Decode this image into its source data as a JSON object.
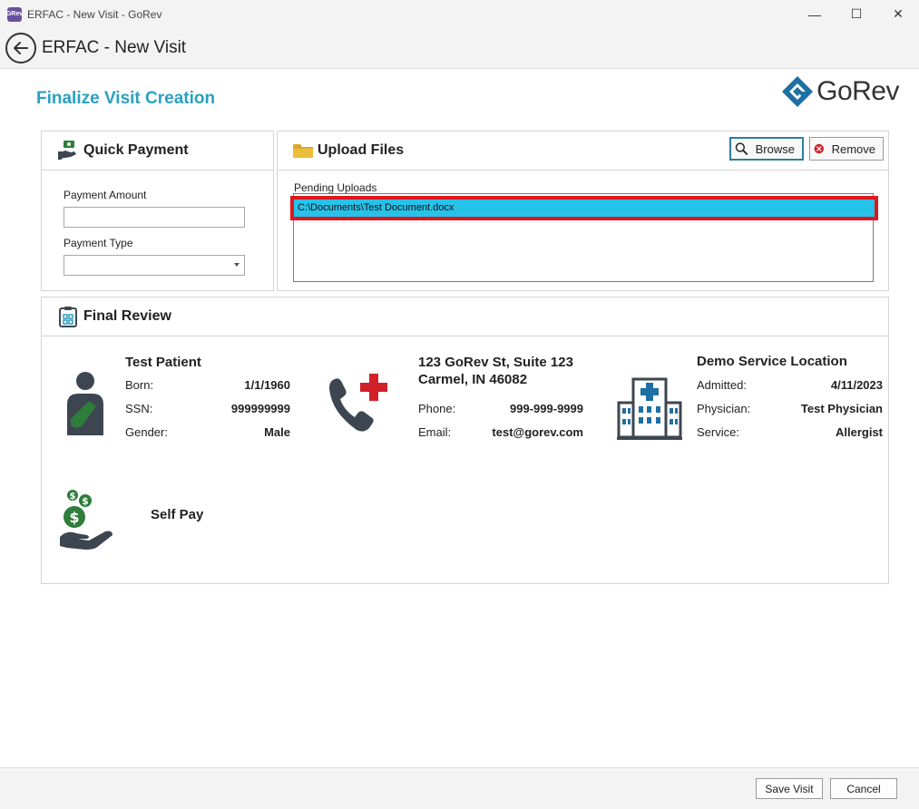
{
  "window": {
    "title": "ERFAC - New Visit - GoRev",
    "app_icon_text": "GRev",
    "minimize": "—",
    "maximize": "☐",
    "close": "✕"
  },
  "header": {
    "title": "ERFAC - New Visit"
  },
  "page": {
    "title": "Finalize Visit Creation"
  },
  "logo": {
    "text": "GoRev",
    "color": "#1e6fa3"
  },
  "quick_payment": {
    "title": "Quick Payment",
    "amount_label": "Payment Amount",
    "amount_value": "",
    "type_label": "Payment Type",
    "type_value": ""
  },
  "upload_files": {
    "title": "Upload Files",
    "browse_label": "Browse",
    "remove_label": "Remove",
    "pending_label": "Pending Uploads",
    "files": [
      "C:\\Documents\\Test Document.docx"
    ]
  },
  "final_review": {
    "title": "Final Review",
    "patient": {
      "name": "Test Patient",
      "born_label": "Born:",
      "born": "1/1/1960",
      "ssn_label": "SSN:",
      "ssn": "999999999",
      "gender_label": "Gender:",
      "gender": "Male"
    },
    "contact": {
      "address_line1": "123 GoRev St, Suite 123",
      "address_line2": "Carmel, IN 46082",
      "phone_label": "Phone:",
      "phone": "999-999-9999",
      "email_label": "Email:",
      "email": "test@gorev.com"
    },
    "location": {
      "name": "Demo Service Location",
      "admitted_label": "Admitted:",
      "admitted": "4/11/2023",
      "physician_label": "Physician:",
      "physician": "Test Physician",
      "service_label": "Service:",
      "service": "Allergist"
    },
    "payer": {
      "name": "Self Pay"
    }
  },
  "footer": {
    "save_label": "Save Visit",
    "cancel_label": "Cancel"
  },
  "colors": {
    "accent": "#2aa0c2",
    "highlight": "#e0161e",
    "selection": "#27c2ea",
    "icon_dark": "#3d4650",
    "icon_green": "#2e7d3a",
    "cross_red": "#d22028"
  }
}
